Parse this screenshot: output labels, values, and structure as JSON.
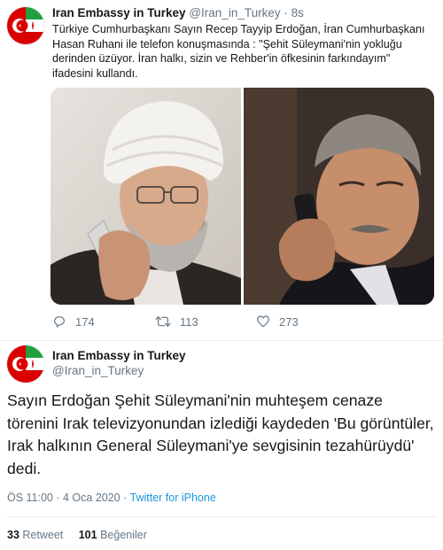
{
  "quoted_tweet": {
    "author_name": "Iran Embassy in Turkey",
    "handle": "@Iran_in_Turkey",
    "separator": "·",
    "time_ago": "8s",
    "text": "Türkiye Cumhurbaşkanı Sayın Recep Tayyip Erdoğan, İran Cumhurbaşkanı Hasan Ruhani ile telefon konuşmasında : \"Şehit Süleymani'nin yokluğu derinden üzüyor. İran halkı, sizin ve Rehber'in öfkesinin farkındayım\" ifadesini kullandı.",
    "replies": "174",
    "retweets": "113",
    "likes": "273",
    "icons": {
      "reply": "reply-icon",
      "retweet": "retweet-icon",
      "like": "heart-icon"
    }
  },
  "main_tweet": {
    "author_name": "Iran Embassy in Turkey",
    "handle": "@Iran_in_Turkey",
    "text": "Sayın Erdoğan Şehit Süleymani'nin muhteşem cenaze törenini Irak televizyonundan izlediği kaydeden 'Bu görüntüler, Irak halkının General Süleymani'ye sevgisinin tezahürüydü'  dedi.",
    "timestamp": "ÖS 11:00 · 4 Oca 2020 · ",
    "source": "Twitter for iPhone",
    "retweet_count": "33",
    "retweet_label": "Retweet",
    "like_count": "101",
    "like_label": "Beğeniler"
  },
  "colors": {
    "text": "#14171a",
    "secondary": "#657786",
    "link": "#1b95e0",
    "divider": "#e6ecf0",
    "flag_red": "#da0000",
    "flag_green": "#239f40"
  }
}
